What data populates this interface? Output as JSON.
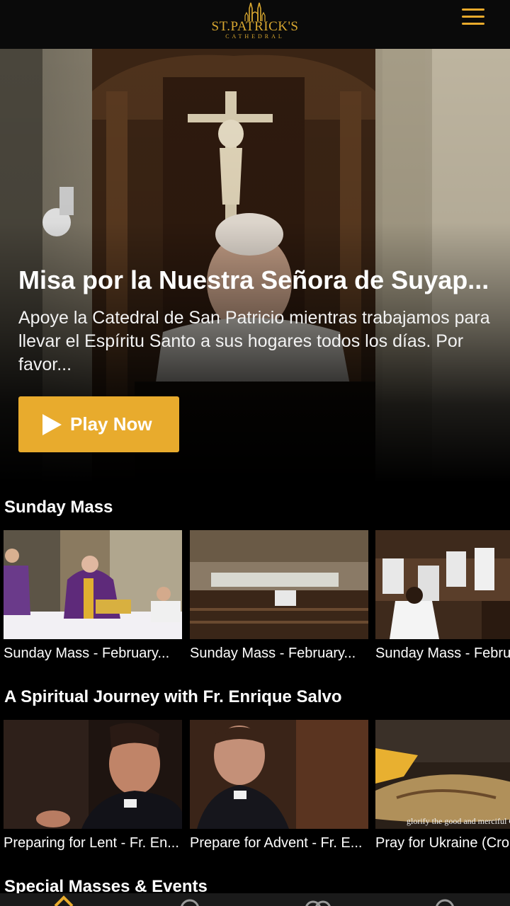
{
  "header": {
    "logo_main": "ST.PATRICK'S",
    "logo_sub": "CATHEDRAL",
    "menu_icon": "hamburger-menu-icon",
    "accent_color": "#e8ab2d"
  },
  "hero": {
    "title": "Misa por la Nuestra Señora de Suyap...",
    "description": "Apoye la Catedral de San Patricio mientras trabajamos para llevar el Espíritu Santo a sus hogares todos los días. Por favor...",
    "play_label": "Play Now",
    "play_icon": "play-icon"
  },
  "sections": [
    {
      "title": "Sunday Mass",
      "items": [
        {
          "label": "Sunday Mass - February..."
        },
        {
          "label": "Sunday Mass - February..."
        },
        {
          "label": "Sunday Mass - Febru"
        }
      ]
    },
    {
      "title": "A Spiritual Journey with Fr. Enrique Salvo",
      "items": [
        {
          "label": "Preparing for Lent - Fr. En..."
        },
        {
          "label": "Prepare for Advent - Fr. E..."
        },
        {
          "label": "Pray for Ukraine (Cro",
          "caption": "glorify the good and merciful C"
        }
      ]
    },
    {
      "title": "Special Masses & Events",
      "items": []
    }
  ],
  "bottom_nav": {
    "items": [
      {
        "icon": "home-icon"
      },
      {
        "icon": "search-icon"
      },
      {
        "icon": "library-icon"
      },
      {
        "icon": "profile-icon"
      }
    ]
  }
}
